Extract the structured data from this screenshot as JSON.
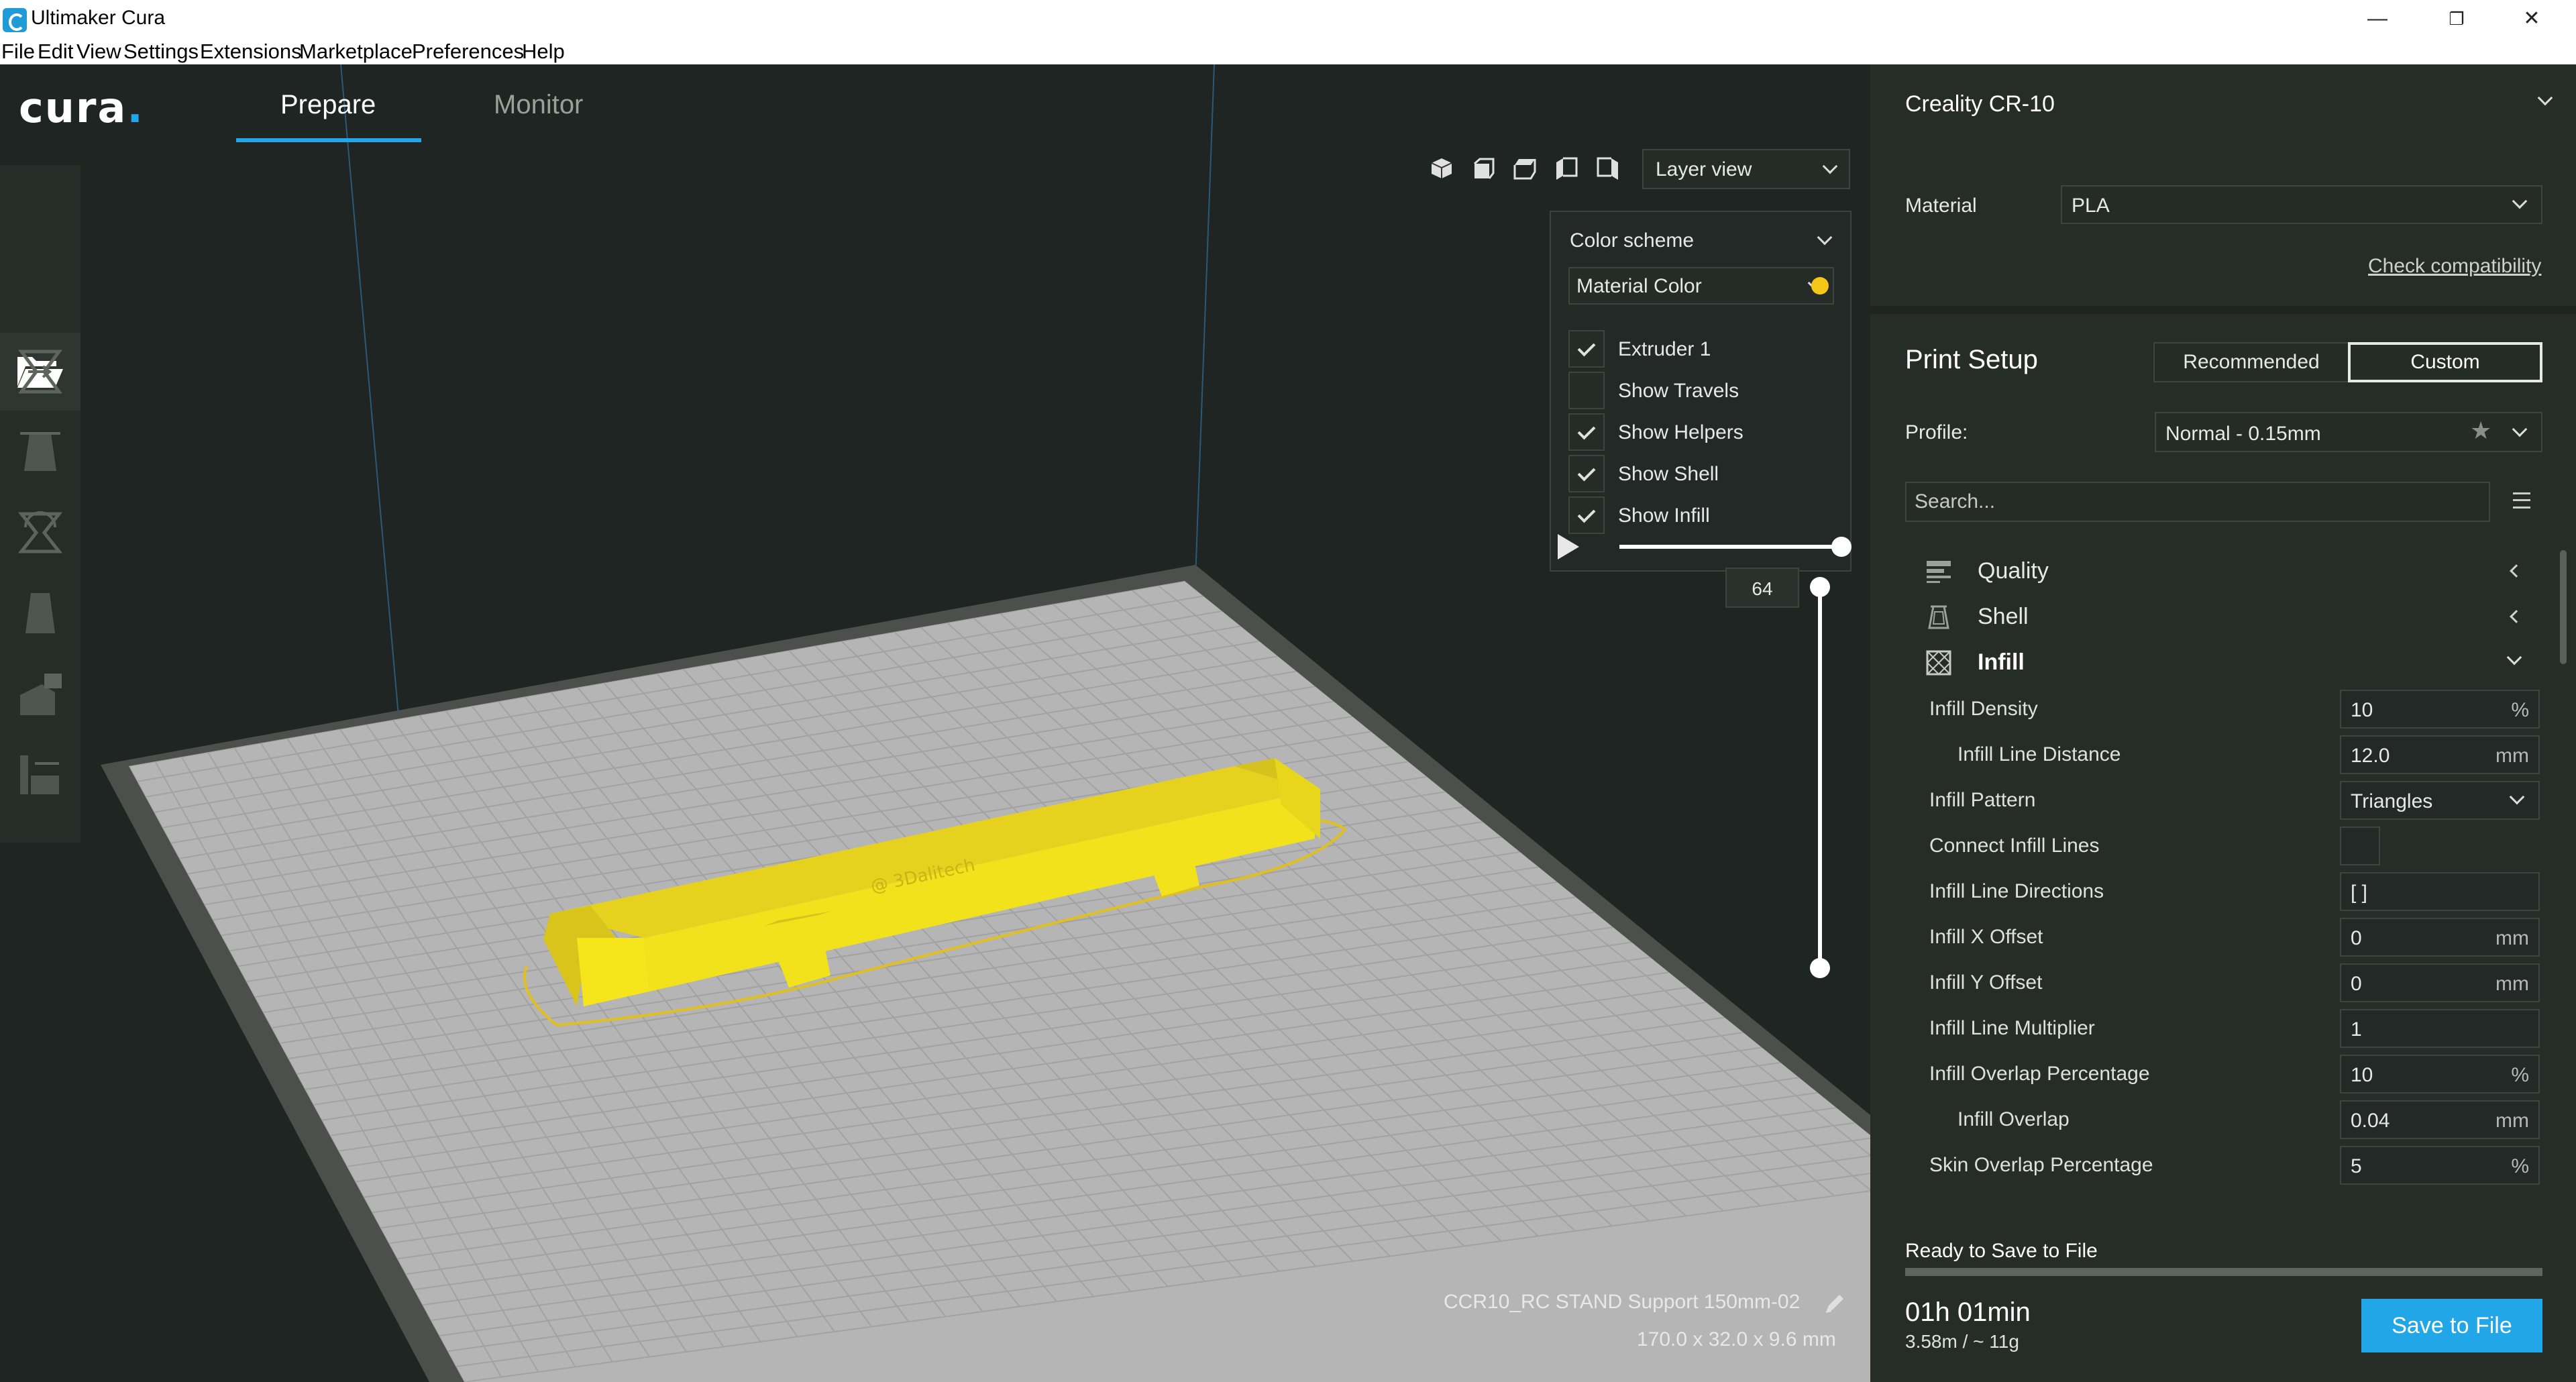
{
  "window": {
    "title": "Ultimaker Cura",
    "controls": [
      "—",
      "❐",
      "✕"
    ]
  },
  "menu": [
    "File",
    "Edit",
    "View",
    "Settings",
    "Extensions",
    "Marketplace",
    "Preferences",
    "Help"
  ],
  "header": {
    "logo_text": "cura",
    "logo_dot": ".",
    "tabs": [
      {
        "label": "Prepare",
        "active": true
      },
      {
        "label": "Monitor",
        "active": false
      }
    ],
    "view_mode": "Layer view",
    "view_icons": [
      "3d-view-icon",
      "front-view-icon",
      "top-view-icon",
      "left-view-icon",
      "right-view-icon"
    ]
  },
  "left_toolbar": {
    "items": [
      "open-file-icon",
      "move-tool-icon",
      "scale-tool-icon",
      "rotate-tool-icon",
      "mirror-tool-icon",
      "per-model-settings-icon",
      "support-blocker-icon"
    ]
  },
  "color_panel": {
    "title": "Color scheme",
    "scheme": "Material Color",
    "options": [
      {
        "label": "Extruder 1",
        "checked": true
      },
      {
        "label": "Show Travels",
        "checked": false
      },
      {
        "label": "Show Helpers",
        "checked": true
      },
      {
        "label": "Show Shell",
        "checked": true
      },
      {
        "label": "Show Infill",
        "checked": true
      }
    ],
    "extruder_color": "#f5c518"
  },
  "layer_slider": {
    "current_layer": "64",
    "max_layer": 64
  },
  "object": {
    "name": "CCR10_RC STAND Support 150mm-02",
    "dimensions": "170.0 x 32.0 x 9.6 mm",
    "model_color": "#f5e21a"
  },
  "printer": {
    "name": "Creality CR-10",
    "material_label": "Material",
    "material": "PLA",
    "check_compat": "Check compatibility"
  },
  "print_setup": {
    "title": "Print Setup",
    "modes": [
      "Recommended",
      "Custom"
    ],
    "active_mode": "Custom",
    "profile_label": "Profile:",
    "profile": "Normal - 0.15mm",
    "search_placeholder": "Search...",
    "categories": [
      {
        "label": "Quality",
        "expanded": false
      },
      {
        "label": "Shell",
        "expanded": false
      },
      {
        "label": "Infill",
        "expanded": true
      }
    ],
    "settings": [
      {
        "label": "Infill Density",
        "value": "10",
        "unit": "%",
        "indent": false
      },
      {
        "label": "Infill Line Distance",
        "value": "12.0",
        "unit": "mm",
        "indent": true
      },
      {
        "label": "Infill Pattern",
        "value": "Triangles",
        "unit": "",
        "indent": false,
        "dropdown": true
      },
      {
        "label": "Connect Infill Lines",
        "value": "",
        "unit": "",
        "indent": false,
        "checkbox": true
      },
      {
        "label": "Infill Line Directions",
        "value": "[ ]",
        "unit": "",
        "indent": false
      },
      {
        "label": "Infill X Offset",
        "value": "0",
        "unit": "mm",
        "indent": false
      },
      {
        "label": "Infill Y Offset",
        "value": "0",
        "unit": "mm",
        "indent": false
      },
      {
        "label": "Infill Line Multiplier",
        "value": "1",
        "unit": "",
        "indent": false
      },
      {
        "label": "Infill Overlap Percentage",
        "value": "10",
        "unit": "%",
        "indent": false
      },
      {
        "label": "Infill Overlap",
        "value": "0.04",
        "unit": "mm",
        "indent": true
      },
      {
        "label": "Skin Overlap Percentage",
        "value": "5",
        "unit": "%",
        "indent": false
      }
    ]
  },
  "output": {
    "status": "Ready to Save to File",
    "progress": 1.0,
    "time": "01h 01min",
    "usage": "3.58m / ~ 11g",
    "save_label": "Save to File"
  },
  "colors": {
    "accent": "#21a6e8",
    "panel": "#262c28",
    "viewport": "#1f2522",
    "build_plate": "#b3b3b3"
  }
}
